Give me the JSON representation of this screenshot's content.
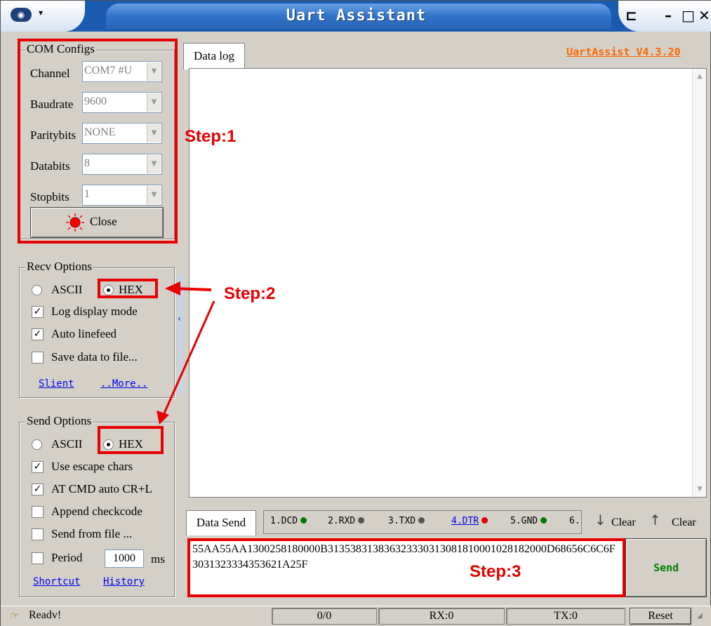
{
  "window": {
    "title": "Uart Assistant",
    "version_link": "UartAssist V4.3.20",
    "system_menu_arrow": "▾",
    "controls": {
      "pin": "⊏",
      "minimize": "–",
      "maximize": "□",
      "close": "✕"
    }
  },
  "com_configs": {
    "title": "COM Configs",
    "fields": [
      {
        "label": "Channel",
        "value": "COM7 #U"
      },
      {
        "label": "Baudrate",
        "value": "9600"
      },
      {
        "label": "Paritybits",
        "value": "NONE"
      },
      {
        "label": "Databits",
        "value": "8"
      },
      {
        "label": "Stopbits",
        "value": "1"
      }
    ],
    "close_button": "Close",
    "status_light_color": "#ff0000"
  },
  "recv_options": {
    "title": "Recv Options",
    "ascii_label": "ASCII",
    "hex_label": "HEX",
    "selected": "HEX",
    "checks": [
      {
        "label": "Log display mode",
        "checked": true
      },
      {
        "label": "Auto linefeed",
        "checked": true
      },
      {
        "label": "Save data to file...",
        "checked": false
      }
    ],
    "links": {
      "silent": "Slient",
      "more": "..More.."
    }
  },
  "send_options": {
    "title": "Send Options",
    "ascii_label": "ASCII",
    "hex_label": "HEX",
    "selected": "HEX",
    "checks": [
      {
        "label": "Use escape chars",
        "checked": true
      },
      {
        "label": "AT CMD auto CR+L",
        "checked": true
      },
      {
        "label": "Append checkcode",
        "checked": false
      },
      {
        "label": "Send from file ...",
        "checked": false
      },
      {
        "label": "Period",
        "checked": false
      }
    ],
    "period_value": "1000",
    "period_unit": "ms",
    "links": {
      "shortcut": "Shortcut",
      "history": "History"
    }
  },
  "data_log": {
    "tab_label": "Data log"
  },
  "data_send": {
    "tab_label": "Data Send",
    "pins": [
      {
        "label": "1.DCD",
        "color": "#007a00",
        "link": false
      },
      {
        "label": "2.RXD",
        "color": "#555555",
        "link": false
      },
      {
        "label": "3.TXD",
        "color": "#555555",
        "link": false
      },
      {
        "label": "4.DTR",
        "color": "#e00000",
        "link": true
      },
      {
        "label": "5.GND",
        "color": "#007a00",
        "link": false
      },
      {
        "label": "6.",
        "color": "",
        "link": false
      }
    ],
    "clear_down": "Clear",
    "clear_up": "Clear",
    "text": "55AA55AA1300258180000B313538313836323330313081810001028182000D68656C6C6F3031323334353621A25F",
    "send_button": "Send"
  },
  "statusbar": {
    "ready": "Readv!",
    "count": "0/0",
    "rx": "RX:0",
    "tx": "TX:0",
    "reset": "Reset"
  },
  "annotations": {
    "step1": "Step:1",
    "step2": "Step:2",
    "step3": "Step:3"
  }
}
